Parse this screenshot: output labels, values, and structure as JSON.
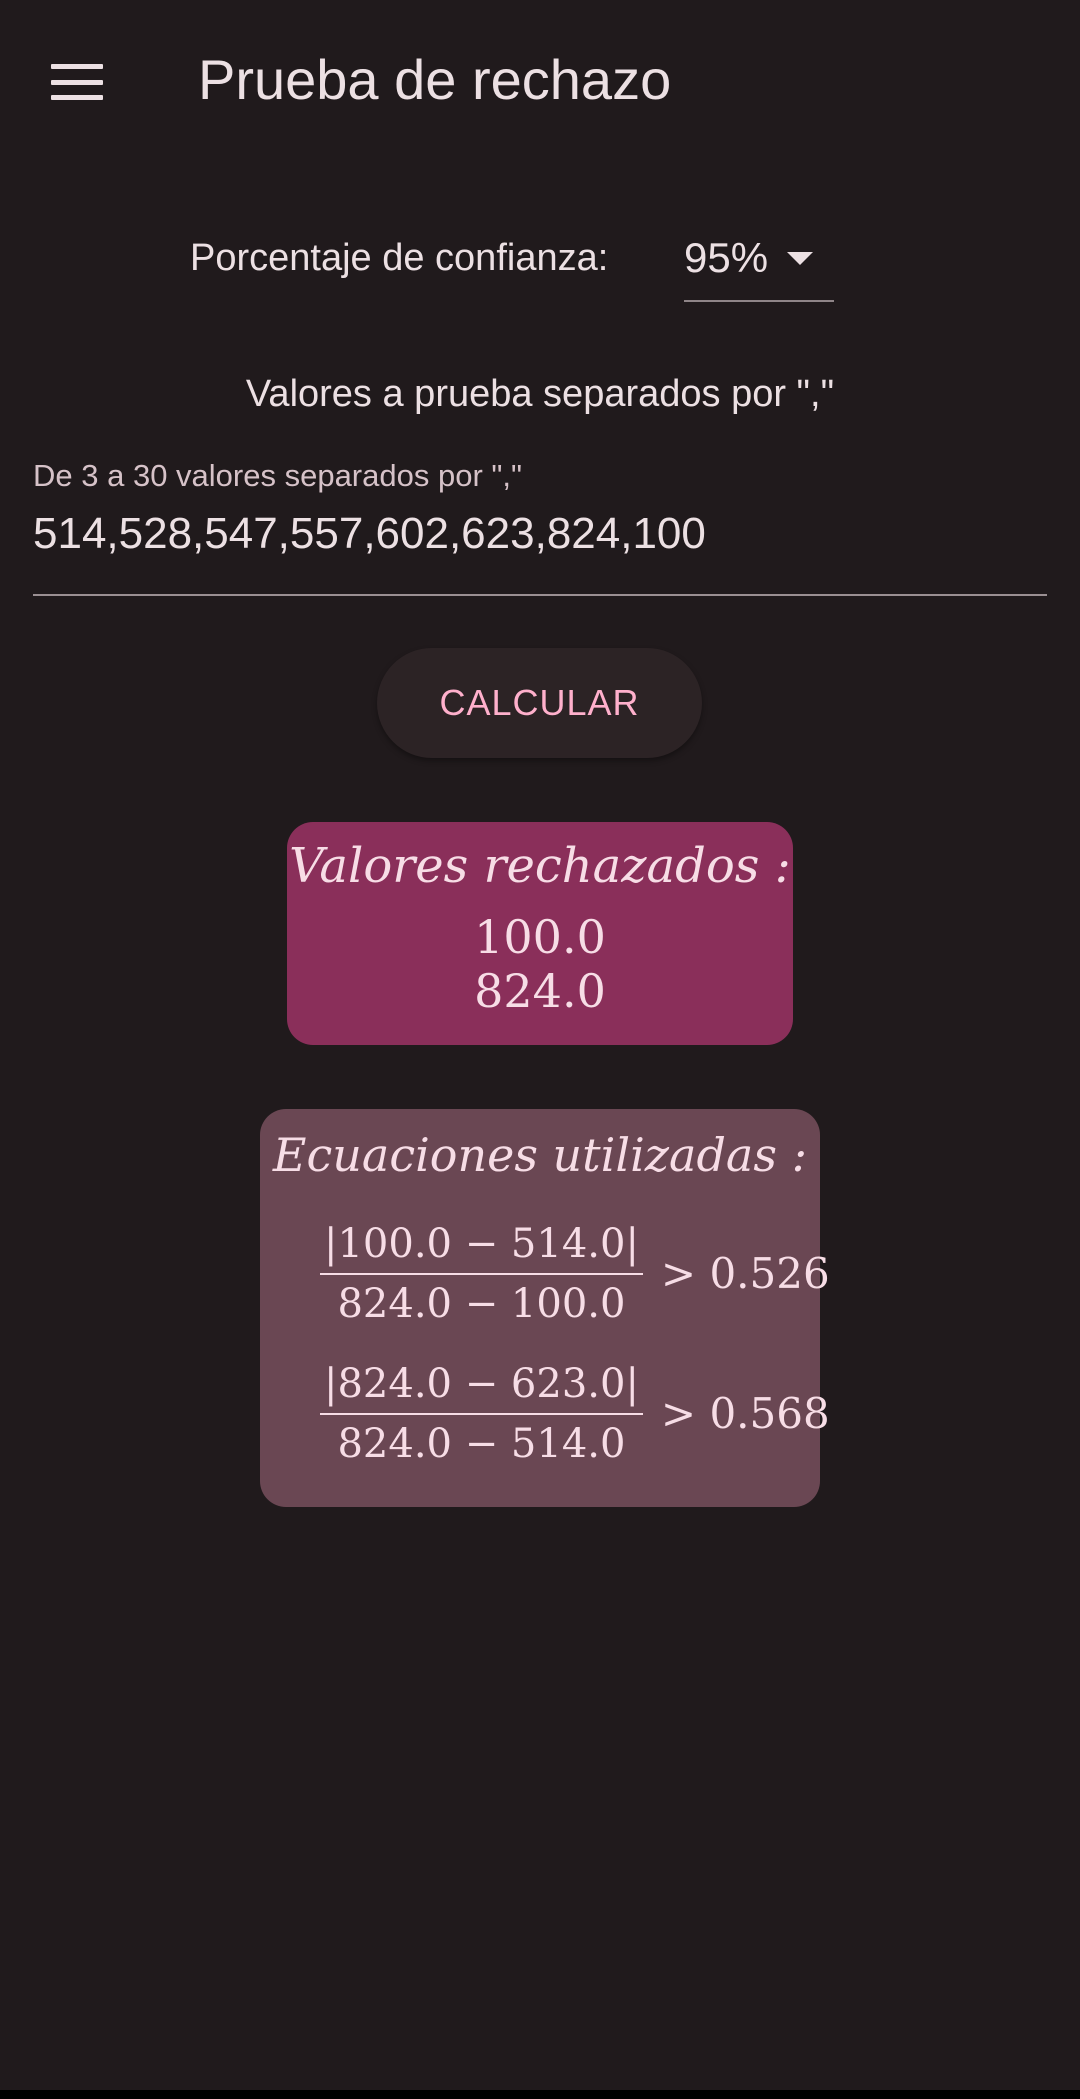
{
  "app_bar": {
    "title": "Prueba de rechazo",
    "menu_icon": "hamburger-menu-icon"
  },
  "confidence": {
    "label": "Porcentaje de confianza:",
    "selected": "95%",
    "dropdown_icon": "dropdown-arrow-icon"
  },
  "values": {
    "prompt": "Valores a prueba separados por \",\"",
    "field_label": "De 3 a 30 valores separados por \",\"",
    "field_value": "514,528,547,557,602,623,824,100"
  },
  "calculate_button": {
    "label": "CALCULAR"
  },
  "rejected": {
    "title": "Valores rechazados :",
    "values": [
      "100.0",
      "824.0"
    ]
  },
  "equations": {
    "title": "Ecuaciones utilizadas :",
    "items": [
      {
        "numerator": "|100.0 − 514.0|",
        "denominator": "824.0 − 100.0",
        "rhs": "> 0.526"
      },
      {
        "numerator": "|824.0 − 623.0|",
        "denominator": "824.0 − 514.0",
        "rhs": "> 0.568"
      }
    ]
  },
  "colors": {
    "background": "#201a1c",
    "accent_text": "#ffb0cc",
    "rejected_card": "#8a2f5a",
    "equations_card": "#6a4753"
  }
}
